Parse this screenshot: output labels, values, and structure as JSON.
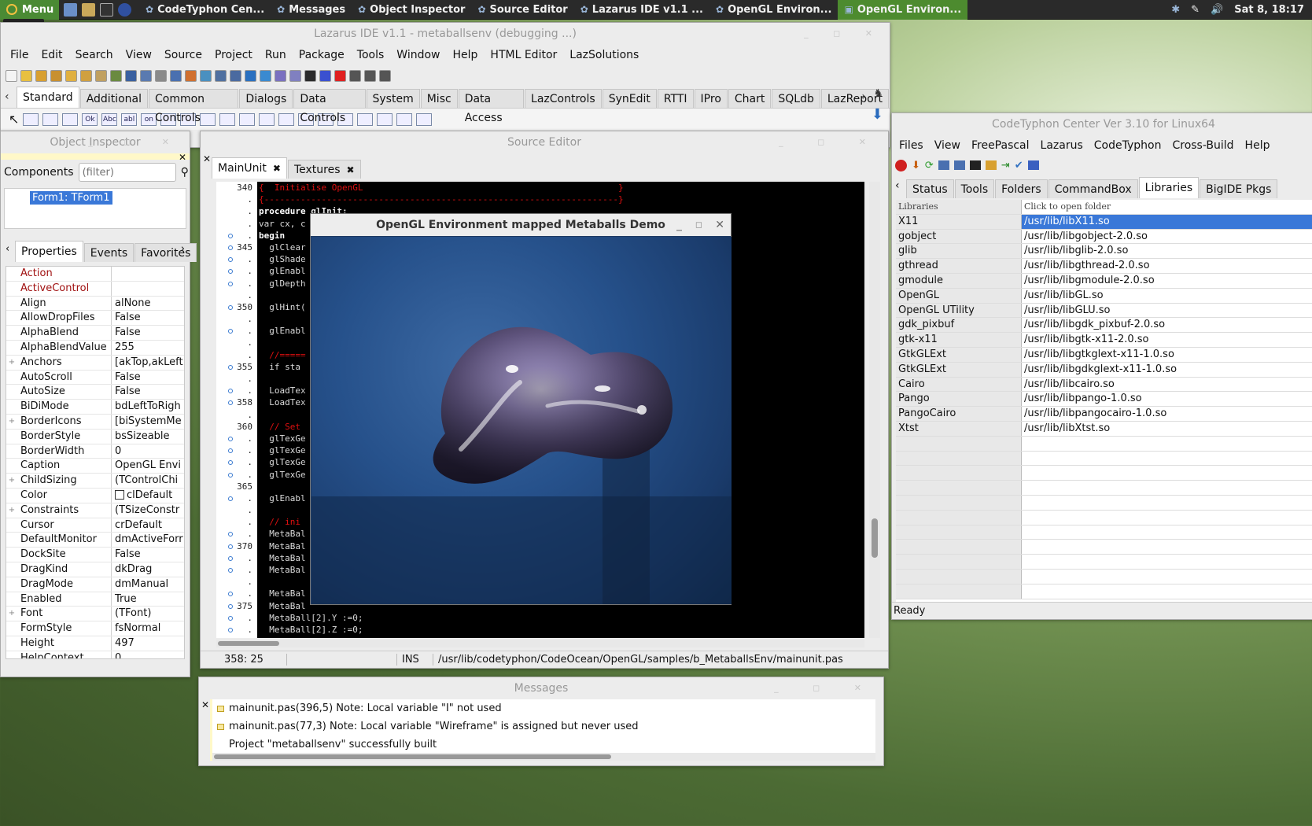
{
  "taskbar": {
    "menu_label": "Menu",
    "menu_tooltip": "Menu",
    "tasks": [
      {
        "label": "CodeTyphon Cen...",
        "active": false
      },
      {
        "label": "Messages",
        "active": false
      },
      {
        "label": "Object Inspector",
        "active": false
      },
      {
        "label": "Source Editor",
        "active": false
      },
      {
        "label": "Lazarus IDE v1.1 ...",
        "active": false
      },
      {
        "label": "OpenGL Environ...",
        "active": false
      },
      {
        "label": "OpenGL Environ...",
        "active": true
      }
    ],
    "clock": "Sat 8, 18:17"
  },
  "ide": {
    "title": "Lazarus IDE v1.1 - metaballsenv (debugging ...)",
    "menu": [
      "File",
      "Edit",
      "Search",
      "View",
      "Source",
      "Project",
      "Run",
      "Package",
      "Tools",
      "Window",
      "Help",
      "HTML Editor",
      "LazSolutions"
    ],
    "palette_tabs": [
      "Standard",
      "Additional",
      "Common Controls",
      "Dialogs",
      "Data Controls",
      "System",
      "Misc",
      "Data Access",
      "LazControls",
      "SynEdit",
      "RTTI",
      "IPro",
      "Chart",
      "SQLdb",
      "LazReport"
    ],
    "palette_items": [
      "Ok",
      "Abc",
      "abl",
      "on"
    ]
  },
  "object_inspector": {
    "title": "Object Inspector",
    "components_label": "Components",
    "filter_placeholder": "(filter)",
    "tree_item": "Form1: TForm1",
    "tabs": [
      "Properties",
      "Events",
      "Favorites"
    ],
    "properties": [
      {
        "name": "Action",
        "value": "",
        "expandable": false,
        "highlight": true
      },
      {
        "name": "ActiveControl",
        "value": "",
        "expandable": false,
        "highlight": true
      },
      {
        "name": "Align",
        "value": "alNone",
        "expandable": false,
        "highlight": false
      },
      {
        "name": "AllowDropFiles",
        "value": "False",
        "expandable": false,
        "highlight": false
      },
      {
        "name": "AlphaBlend",
        "value": "False",
        "expandable": false,
        "highlight": false
      },
      {
        "name": "AlphaBlendValue",
        "value": "255",
        "expandable": false,
        "highlight": false
      },
      {
        "name": "Anchors",
        "value": "[akTop,akLeft",
        "expandable": true,
        "highlight": false
      },
      {
        "name": "AutoScroll",
        "value": "False",
        "expandable": false,
        "highlight": false
      },
      {
        "name": "AutoSize",
        "value": "False",
        "expandable": false,
        "highlight": false
      },
      {
        "name": "BiDiMode",
        "value": "bdLeftToRigh",
        "expandable": false,
        "highlight": false
      },
      {
        "name": "BorderIcons",
        "value": "[biSystemMe",
        "expandable": true,
        "highlight": false
      },
      {
        "name": "BorderStyle",
        "value": "bsSizeable",
        "expandable": false,
        "highlight": false
      },
      {
        "name": "BorderWidth",
        "value": "0",
        "expandable": false,
        "highlight": false
      },
      {
        "name": "Caption",
        "value": "OpenGL Envi",
        "expandable": false,
        "highlight": false
      },
      {
        "name": "ChildSizing",
        "value": "(TControlChi",
        "expandable": true,
        "highlight": false
      },
      {
        "name": "Color",
        "value": "clDefault",
        "expandable": false,
        "highlight": false
      },
      {
        "name": "Constraints",
        "value": "(TSizeConstr",
        "expandable": true,
        "highlight": false
      },
      {
        "name": "Cursor",
        "value": "crDefault",
        "expandable": false,
        "highlight": false
      },
      {
        "name": "DefaultMonitor",
        "value": "dmActiveForr",
        "expandable": false,
        "highlight": false
      },
      {
        "name": "DockSite",
        "value": "False",
        "expandable": false,
        "highlight": false
      },
      {
        "name": "DragKind",
        "value": "dkDrag",
        "expandable": false,
        "highlight": false
      },
      {
        "name": "DragMode",
        "value": "dmManual",
        "expandable": false,
        "highlight": false
      },
      {
        "name": "Enabled",
        "value": "True",
        "expandable": false,
        "highlight": false
      },
      {
        "name": "Font",
        "value": "(TFont)",
        "expandable": true,
        "highlight": false
      },
      {
        "name": "FormStyle",
        "value": "fsNormal",
        "expandable": false,
        "highlight": false
      },
      {
        "name": "Height",
        "value": "497",
        "expandable": false,
        "highlight": false
      },
      {
        "name": "HelpContext",
        "value": "0",
        "expandable": false,
        "highlight": false
      }
    ]
  },
  "source_editor": {
    "title": "Source Editor",
    "tabs": [
      "MainUnit",
      "Textures"
    ],
    "gutter": [
      {
        "num": "340",
        "dot": false
      },
      {
        "num": ".",
        "dot": false
      },
      {
        "num": ".",
        "dot": false
      },
      {
        "num": ".",
        "dot": false
      },
      {
        "num": ".",
        "dot": true
      },
      {
        "num": "345",
        "dot": true
      },
      {
        "num": ".",
        "dot": true
      },
      {
        "num": ".",
        "dot": true
      },
      {
        "num": ".",
        "dot": true
      },
      {
        "num": ".",
        "dot": false
      },
      {
        "num": "350",
        "dot": true
      },
      {
        "num": ".",
        "dot": false
      },
      {
        "num": ".",
        "dot": true
      },
      {
        "num": ".",
        "dot": false
      },
      {
        "num": ".",
        "dot": false
      },
      {
        "num": "355",
        "dot": true
      },
      {
        "num": ".",
        "dot": false
      },
      {
        "num": ".",
        "dot": true
      },
      {
        "num": "358",
        "dot": true
      },
      {
        "num": ".",
        "dot": false
      },
      {
        "num": "360",
        "dot": false
      },
      {
        "num": ".",
        "dot": true
      },
      {
        "num": ".",
        "dot": true
      },
      {
        "num": ".",
        "dot": true
      },
      {
        "num": ".",
        "dot": true
      },
      {
        "num": "365",
        "dot": false
      },
      {
        "num": ".",
        "dot": true
      },
      {
        "num": ".",
        "dot": false
      },
      {
        "num": ".",
        "dot": false
      },
      {
        "num": ".",
        "dot": true
      },
      {
        "num": "370",
        "dot": true
      },
      {
        "num": ".",
        "dot": true
      },
      {
        "num": ".",
        "dot": true
      },
      {
        "num": ".",
        "dot": false
      },
      {
        "num": ".",
        "dot": true
      },
      {
        "num": "375",
        "dot": true
      },
      {
        "num": ".",
        "dot": true
      },
      {
        "num": ".",
        "dot": true
      }
    ],
    "code": [
      {
        "t": "{  Initialise OpenGL                                                 }",
        "c": "cm"
      },
      {
        "t": "{--------------------------------------------------------------------}",
        "c": "cm"
      },
      {
        "t": "procedure glInit;",
        "c": "kw"
      },
      {
        "t": "var cx, c",
        "c": ""
      },
      {
        "t": "begin",
        "c": "kw"
      },
      {
        "t": "  glClear",
        "c": ""
      },
      {
        "t": "  glShade",
        "c": ""
      },
      {
        "t": "  glEnabl",
        "c": ""
      },
      {
        "t": "  glDepth",
        "c": ""
      },
      {
        "t": "",
        "c": ""
      },
      {
        "t": "  glHint(                                                                   calculations",
        "c": "mixed"
      },
      {
        "t": "",
        "c": ""
      },
      {
        "t": "  glEnabl",
        "c": ""
      },
      {
        "t": "",
        "c": ""
      },
      {
        "t": "  //=====",
        "c": "cm"
      },
      {
        "t": "  if sta",
        "c": ""
      },
      {
        "t": "",
        "c": ""
      },
      {
        "t": "  LoadTex",
        "c": ""
      },
      {
        "t": "  LoadTex",
        "c": ""
      },
      {
        "t": "",
        "c": ""
      },
      {
        "t": "  // Set",
        "c": "cm"
      },
      {
        "t": "  glTexGe",
        "c": ""
      },
      {
        "t": "  glTexGe",
        "c": ""
      },
      {
        "t": "  glTexGe",
        "c": ""
      },
      {
        "t": "  glTexGe",
        "c": ""
      },
      {
        "t": "",
        "c": ""
      },
      {
        "t": "  glEnabl",
        "c": ""
      },
      {
        "t": "",
        "c": ""
      },
      {
        "t": "  // ini",
        "c": "cm"
      },
      {
        "t": "  MetaBal",
        "c": ""
      },
      {
        "t": "  MetaBal",
        "c": ""
      },
      {
        "t": "  MetaBal",
        "c": ""
      },
      {
        "t": "  MetaBal",
        "c": ""
      },
      {
        "t": "",
        "c": ""
      },
      {
        "t": "  MetaBal",
        "c": ""
      },
      {
        "t": "  MetaBal",
        "c": ""
      },
      {
        "t": "  MetaBall[2].Y :=0;",
        "c": ""
      },
      {
        "t": "  MetaBall[2].Z :=0;",
        "c": ""
      }
    ],
    "status": {
      "position": "358: 25",
      "mode": "INS",
      "file": "/usr/lib/codetyphon/CodeOcean/OpenGL/samples/b_MetaballsEnv/mainunit.pas"
    }
  },
  "messages": {
    "title": "Messages",
    "items": [
      {
        "text": "mainunit.pas(396,5) Note: Local variable \"I\" not used",
        "icon": true
      },
      {
        "text": "mainunit.pas(77,3) Note: Local variable \"Wireframe\" is assigned but never used",
        "icon": true
      },
      {
        "text": "Project \"metaballsenv\" successfully built",
        "icon": false
      }
    ]
  },
  "opengl_window": {
    "title": "OpenGL Environment mapped Metaballs Demo"
  },
  "codetyphon": {
    "title": "CodeTyphon Center Ver 3.10 for Linux64",
    "menu": [
      "Files",
      "View",
      "FreePascal",
      "Lazarus",
      "CodeTyphon",
      "Cross-Build",
      "Help"
    ],
    "tabs": [
      "Status",
      "Tools",
      "Folders",
      "CommandBox",
      "Libraries",
      "BigIDE Pkgs"
    ],
    "col1": "Libraries",
    "col2": "Click to open folder",
    "rows": [
      {
        "name": "X11",
        "path": "/usr/lib/libX11.so",
        "sel": true
      },
      {
        "name": "gobject",
        "path": "/usr/lib/libgobject-2.0.so"
      },
      {
        "name": "glib",
        "path": "/usr/lib/libglib-2.0.so"
      },
      {
        "name": "gthread",
        "path": "/usr/lib/libgthread-2.0.so"
      },
      {
        "name": "gmodule",
        "path": "/usr/lib/libgmodule-2.0.so"
      },
      {
        "name": "OpenGL",
        "path": "/usr/lib/libGL.so"
      },
      {
        "name": "OpenGL UTility",
        "path": "/usr/lib/libGLU.so"
      },
      {
        "name": "gdk_pixbuf",
        "path": "/usr/lib/libgdk_pixbuf-2.0.so"
      },
      {
        "name": "gtk-x11",
        "path": "/usr/lib/libgtk-x11-2.0.so"
      },
      {
        "name": "GtkGLExt",
        "path": "/usr/lib/libgtkglext-x11-1.0.so"
      },
      {
        "name": "GtkGLExt",
        "path": "/usr/lib/libgdkglext-x11-1.0.so"
      },
      {
        "name": "Cairo",
        "path": "/usr/lib/libcairo.so"
      },
      {
        "name": "Pango",
        "path": "/usr/lib/libpango-1.0.so"
      },
      {
        "name": "PangoCairo",
        "path": "/usr/lib/libpangocairo-1.0.so"
      },
      {
        "name": "Xtst",
        "path": "/usr/lib/libXtst.so"
      }
    ],
    "status": "Ready"
  }
}
